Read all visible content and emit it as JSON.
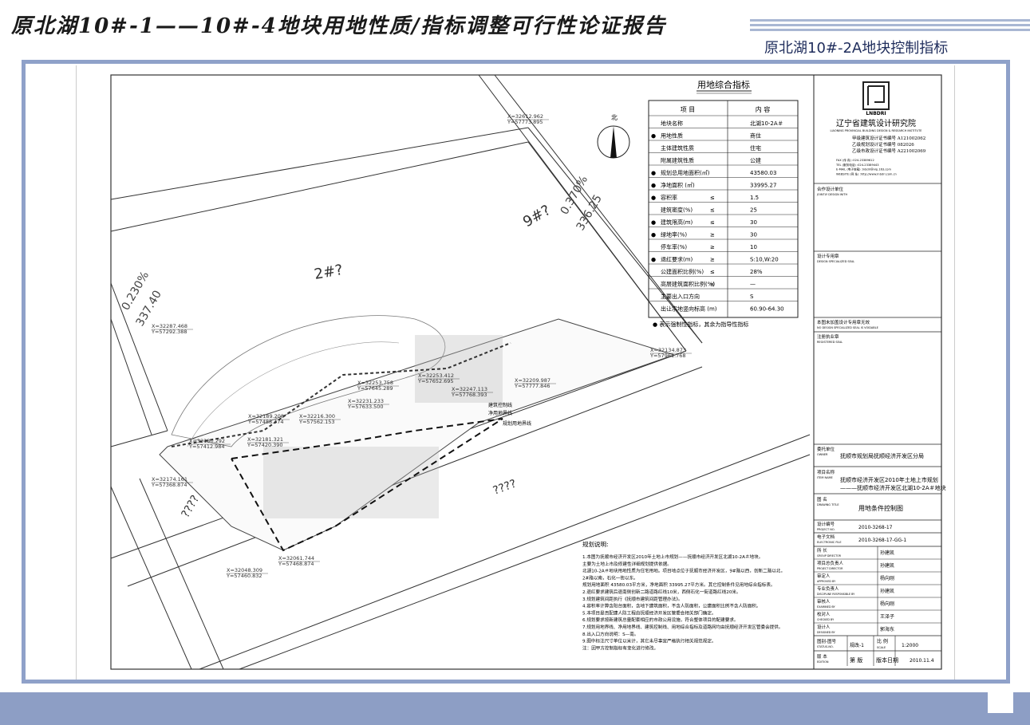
{
  "header": {
    "title": "原北湖10#-1——10#-4地块用地性质/指标调整可行性论证报告",
    "subtitle": "原北湖10#-2A地块控制指标"
  },
  "drawing": {
    "north_label": "北",
    "road_labels": [
      "2#?",
      "9#?",
      "????",
      "????"
    ],
    "coords": [
      "X=32612.962\nY=57773.895",
      "X=32287.468\nY=57292.388",
      "X=32134.873\nY=57961.768",
      "X=32253.758\nY=57645.289",
      "X=32253.412\nY=57652.695",
      "X=32247.113\nY=57768.393",
      "X=32209.987\nY=57777.846",
      "X=32231.233\nY=57633.500",
      "X=32189.208\nY=57488.474",
      "X=32216.300\nY=57562.153",
      "X=32180.292\nY=57412.984",
      "X=32181.321\nY=57420.390",
      "X=32174.161\nY=57368.874",
      "X=32061.744\nY=57468.874",
      "X=32048.309\nY=57460.832"
    ],
    "slope_labels": [
      "0.370%",
      "336.25",
      "0.230%",
      "337.40"
    ],
    "line_labels": [
      "建筑控制线",
      "净用地界线",
      "规划用地界线"
    ]
  },
  "indicator_table": {
    "title": "用地综合指标",
    "header": [
      "项  目",
      "内  容"
    ],
    "rows": [
      {
        "bullet": "",
        "item": "地块名称",
        "op": "",
        "value": "北湖10-2A＃"
      },
      {
        "bullet": "●",
        "item": "用地性质",
        "op": "",
        "value": "商住"
      },
      {
        "bullet": "",
        "item": "主体建筑性质",
        "op": "",
        "value": "住宅"
      },
      {
        "bullet": "",
        "item": "附属建筑性质",
        "op": "",
        "value": "公建"
      },
      {
        "bullet": "●",
        "item": "规划总用地面积(㎡)",
        "op": "",
        "value": "43580.03"
      },
      {
        "bullet": "●",
        "item": "净地面积 (㎡)",
        "op": "",
        "value": "33995.27"
      },
      {
        "bullet": "●",
        "item": "容积率",
        "op": "≤",
        "value": "1.5"
      },
      {
        "bullet": "",
        "item": "建筑密度(%)",
        "op": "≤",
        "value": "25"
      },
      {
        "bullet": "●",
        "item": "建筑限高(m)",
        "op": "≤",
        "value": "30"
      },
      {
        "bullet": "●",
        "item": "绿地率(%)",
        "op": "≥",
        "value": "30"
      },
      {
        "bullet": "",
        "item": "停车率(%)",
        "op": "≥",
        "value": "10"
      },
      {
        "bullet": "●",
        "item": "退红要求(m)",
        "op": "≥",
        "value": "S:10,W:20"
      },
      {
        "bullet": "",
        "item": "公建面积比例(%)",
        "op": "≤",
        "value": "28%"
      },
      {
        "bullet": "",
        "item": "高层建筑面积比例(%)",
        "op": "≤",
        "value": "—"
      },
      {
        "bullet": "",
        "item": "主要出入口方向",
        "op": "",
        "value": "S"
      },
      {
        "bullet": "",
        "item": "出让宗地竖向标高 (m)",
        "op": "",
        "value": "60.90-64.30"
      }
    ],
    "note": "● 表示强制性指标，其余为指导性指标"
  },
  "notes": {
    "title": "规划说明:",
    "lines": [
      "1.本图为抚顺市经济开发区2010年土地上市规划——抚顺市经济开发区北湖10-2A＃地块。",
      "  主要为土地上市及修建性详细规划提供依据。",
      "  北湖10-2A＃地块用地性质为住宅用地。项目地点位于抚顺市经济开发区，9#路以西，创新二路以北，",
      "  2#路以南，石化一街以东。",
      "  规划用地面积 43580.03平方米，净地面积 33995.27平方米。其它控制条件见用地综合指标表。",
      "2.退红要求建筑后退南侧创新二路道路红线10米，西侧石化一街道路红线20米。",
      "3.规划建筑间距执行《抚顺市建筑间距管理办法》。",
      "4.容积率计算含阳台面积，含地下建筑面积，不含人防面积，公建面积比例不含人防面积。",
      "5.本项目是否配建人防工程由抚顺经济开发区管委会相关部门确定。",
      "6.规划要求按新建筑总量配套相应的市政公用设施，符合整体项目的配建要求。",
      "7.规划用地界线、净用地界线、建筑控制线、用地综合指标及道路网均由抚顺经济开发区管委会提供。",
      "8.出入口方向说明：S—南。",
      "9.图中标注尺寸单位以米计，其它未尽事宜严格执行相关规范规定。",
      "注：因甲方控制指标有变化进行修改。"
    ]
  },
  "title_block": {
    "logo_text": "LNBDRI",
    "institute": "辽宁省建筑设计研究院",
    "institute_en": "LIAONING PROVINCIAL BUILDING DESIGN & RESEARCH INSTITUTE",
    "certs": [
      "甲级建筑设计证书编号 A121002062",
      "乙级规划设计证书编号 082026",
      "乙级市政设计证书编号 A221002069"
    ],
    "contact": [
      "FAX  (传  真) :024-23389612",
      "TEL  (服务电话) :024-23389443",
      "E-MAIL (电子信箱) :lnbdri@vip.163.com",
      "WEBSITE (网  址) :http://www.lnbdri.com.cn"
    ],
    "joint": {
      "cn": "合作设计单位",
      "en": "JOINTLY DESIGN WITH"
    },
    "seal": {
      "cn": "设计专用章",
      "en": "DESIGN SPECIALIZED SEAL"
    },
    "invalid": {
      "cn": "本图未加盖设计专用章无效",
      "en": "NO DESIGN SPECIALIZED SEAL IS VOIDABLE"
    },
    "registered": {
      "cn": "注册执业章",
      "en": "REGISTERED SEAL"
    },
    "owner": {
      "cn": "委托单位",
      "en": "OWNER",
      "value": "抚顺市规划局抚顺经济开发区分局"
    },
    "item": {
      "cn": "项目名称",
      "en": "ITEM NAME",
      "value1": "抚顺市经济开发区2010年土地上市规划",
      "value2": "———抚顺市经济开发区北湖10-2A＃地块"
    },
    "drawing": {
      "cn": "图 名",
      "en": "DRAWING TITLE",
      "value": "用地条件控制图"
    },
    "project_no": {
      "cn": "设计编号",
      "en": "PROJECT NO.",
      "value": "2010-3268-17"
    },
    "efile": {
      "cn": "电子文档",
      "en": "ELECTRONIC FILE",
      "value": "2010-3268-17-GG-1"
    },
    "staff": [
      {
        "cn": "所 长",
        "en": "GROUP DIRECTOR",
        "name": "孙建凯"
      },
      {
        "cn": "项目总负责人",
        "en": "PROJECT DIRECTOR",
        "name": "孙建凯"
      },
      {
        "cn": "审定人",
        "en": "APPROVED BY",
        "name": "杨向刚"
      },
      {
        "cn": "专业负责人",
        "en": "DISCIPLINE RESPONSIBLE BY",
        "name": "孙建凯"
      },
      {
        "cn": "审核人",
        "en": "EXAMINED BY",
        "name": "杨向刚"
      },
      {
        "cn": "校对人",
        "en": "CHECKED BY",
        "name": "王泽子"
      },
      {
        "cn": "设计人",
        "en": "DESIGNED BY",
        "name": "郭海东"
      }
    ],
    "status": {
      "cn": "图别-图号",
      "en": "STATUS-NO.",
      "value": "规改-1",
      "scale_cn": "比 例",
      "scale_en": "SCALE",
      "scale": "1:2000"
    },
    "edition": {
      "cn": "版 本",
      "en": "EDITION",
      "ver": "第  版",
      "date_label": "版本日期",
      "date": "2010.11.4"
    }
  }
}
